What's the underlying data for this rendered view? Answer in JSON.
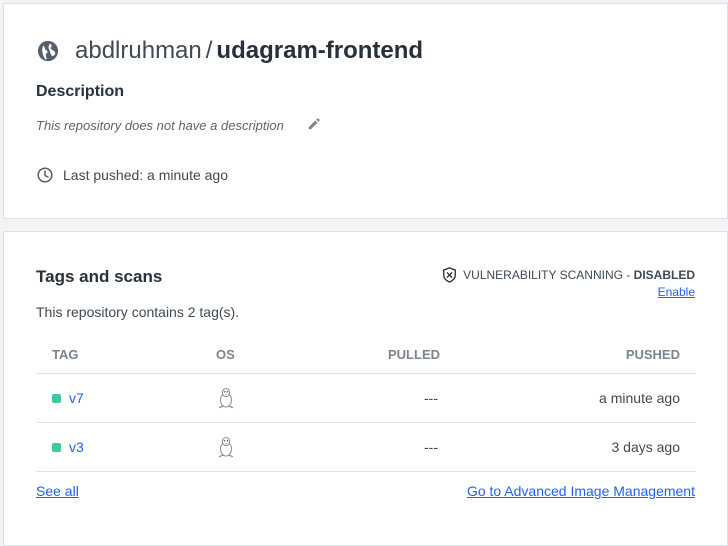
{
  "header": {
    "owner": "abdlruhman",
    "separator": "/",
    "repo_name": "udagram-frontend",
    "description_heading": "Description",
    "description_text": "This repository does not have a description",
    "last_pushed": "Last pushed: a minute ago"
  },
  "tags_section": {
    "title": "Tags and scans",
    "count_text": "This repository contains 2 tag(s).",
    "scanning_label": "VULNERABILITY SCANNING",
    "scanning_dash": " - ",
    "scanning_status": "DISABLED",
    "enable_label": "Enable",
    "columns": {
      "tag": "TAG",
      "os": "OS",
      "pulled": "PULLED",
      "pushed": "PUSHED"
    },
    "rows": [
      {
        "tag": "v7",
        "os_icon": "linux-icon",
        "pulled": "---",
        "pushed": "a minute ago"
      },
      {
        "tag": "v3",
        "os_icon": "linux-icon",
        "pulled": "---",
        "pushed": "3 days ago"
      }
    ],
    "see_all_label": "See all",
    "advanced_link_label": "Go to Advanced Image Management"
  },
  "colors": {
    "accent": "#1d63ed",
    "tag_dot": "#3fc8a3",
    "text": "#27313b",
    "muted": "#7a8590"
  },
  "icons": {
    "visibility": "globe-icon",
    "edit": "pencil-icon",
    "time": "clock-icon",
    "scanning": "shield-x-icon",
    "os": "linux-icon"
  }
}
